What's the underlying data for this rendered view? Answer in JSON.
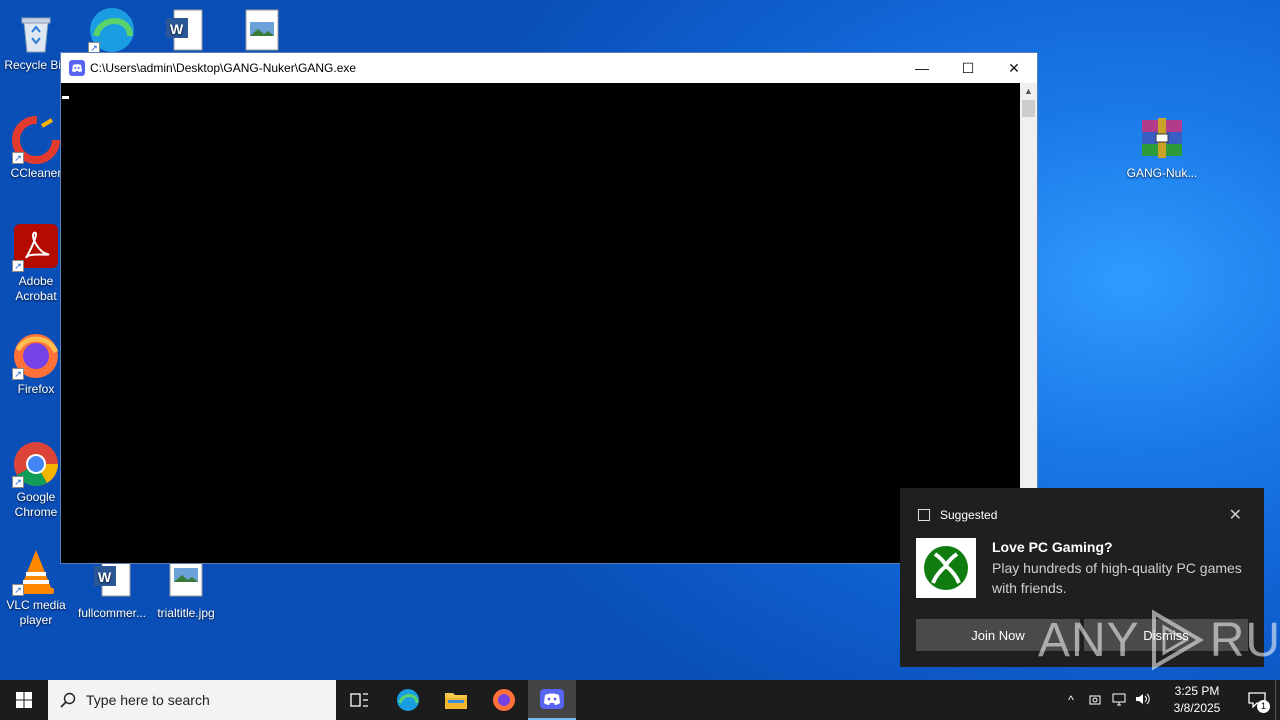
{
  "desktop_icons": {
    "recycle_bin": "Recycle Bin",
    "ccleaner": "CCleaner",
    "acrobat": "Adobe Acrobat",
    "firefox": "Firefox",
    "chrome": "Google Chrome",
    "vlc": "VLC media player",
    "fullcomment": "fullcommer...",
    "trialtitle": "trialtitle.jpg",
    "gang_archive": "GANG-Nuk..."
  },
  "console_window": {
    "title": "C:\\Users\\admin\\Desktop\\GANG-Nuker\\GANG.exe",
    "minimize": "—",
    "maximize": "☐",
    "close": "✕"
  },
  "notification": {
    "category": "Suggested",
    "close": "✕",
    "headline": "Love PC Gaming?",
    "message": "Play hundreds of high-quality PC games with friends.",
    "primary_action": "Join Now",
    "secondary_action": "Dismiss"
  },
  "watermark": {
    "left": "ANY",
    "right": "RUN"
  },
  "taskbar": {
    "search_placeholder": "Type here to search",
    "time": "3:25 PM",
    "date": "3/8/2025",
    "notification_count": "1"
  },
  "colors": {
    "discord_brand": "#5865f2",
    "xbox_green": "#107c10",
    "taskbar_bg": "#1c1c1c"
  }
}
